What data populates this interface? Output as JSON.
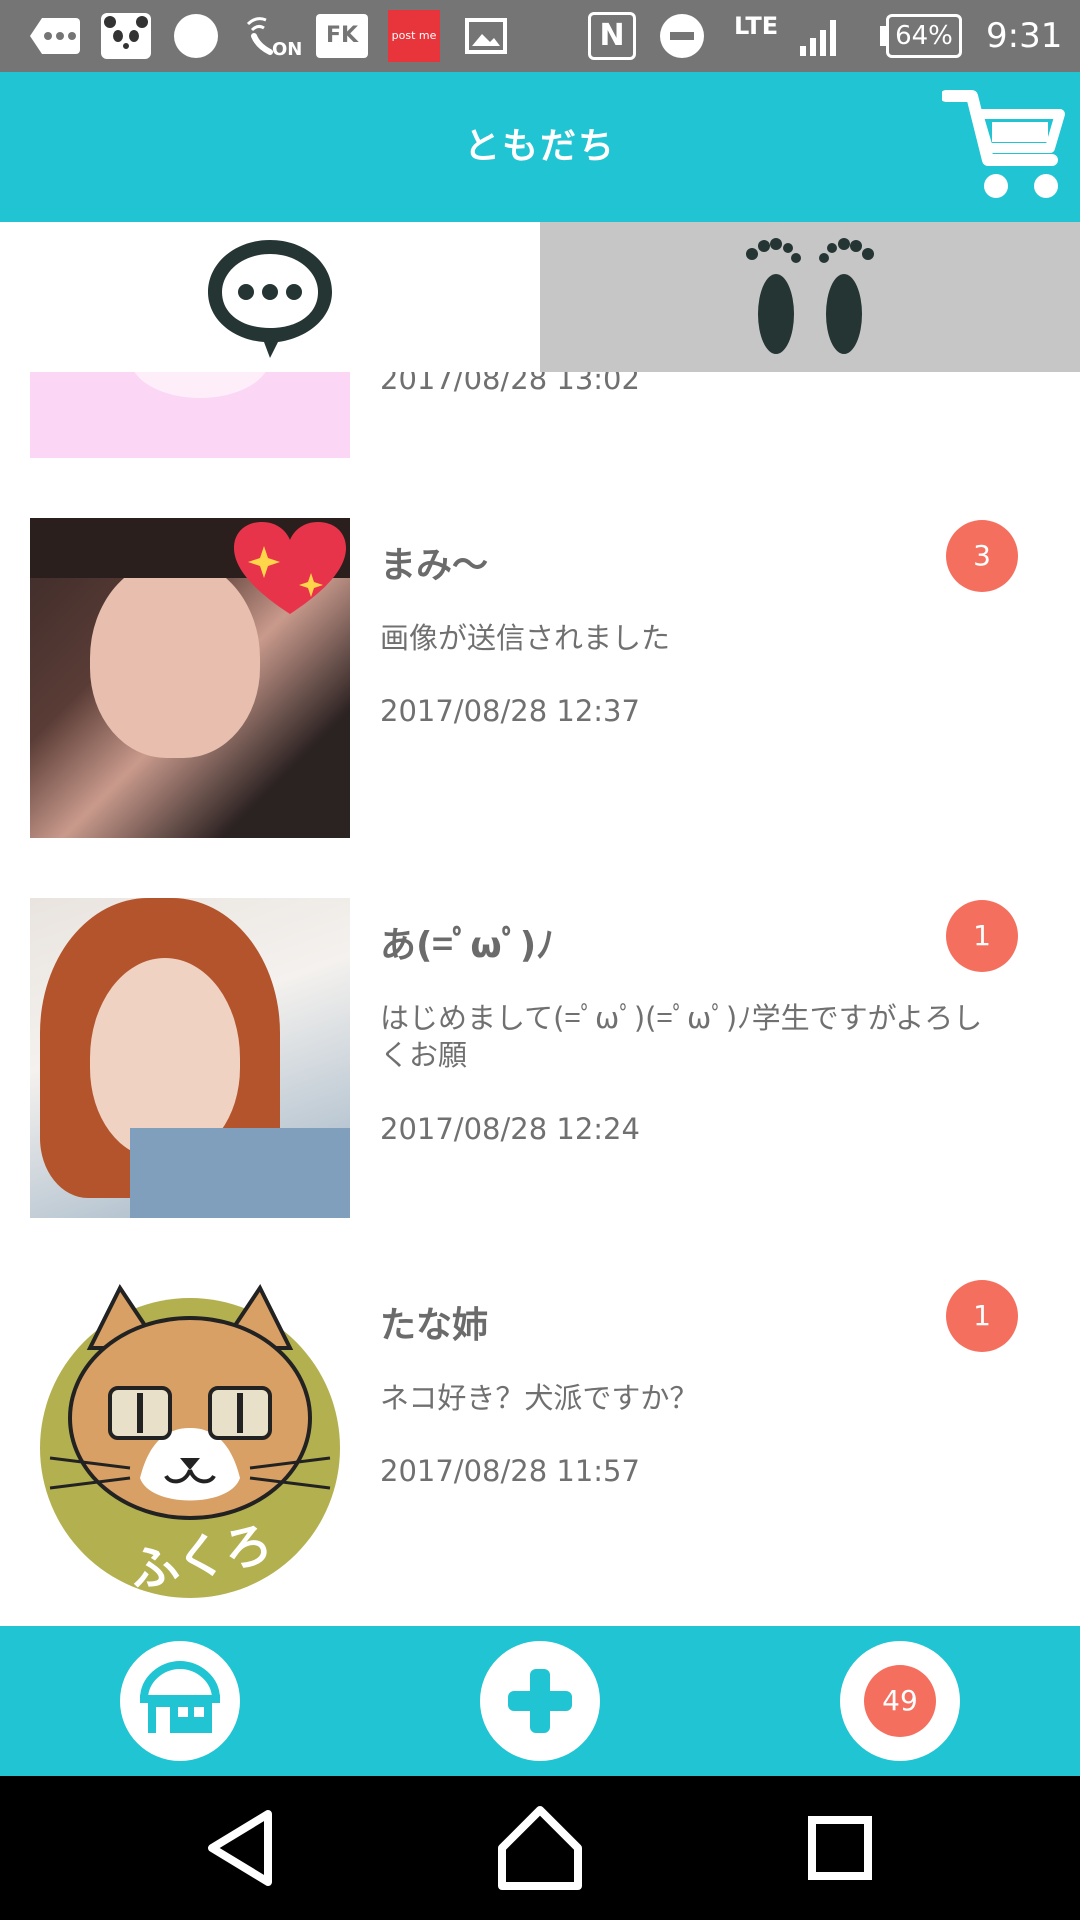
{
  "status_bar": {
    "network": "LTE",
    "battery": "64%",
    "time": "9:31",
    "nfc_label": "N",
    "fk_label": "FK",
    "postme_label": "post me",
    "on_label": "ON",
    "icons": [
      "chat-dots-icon",
      "panda-icon",
      "circle-icon",
      "wifi-calling-icon",
      "fk-app-icon",
      "postme-app-icon",
      "image-icon",
      "nfc-icon",
      "do-not-disturb-icon",
      "signal-icon",
      "battery-icon"
    ]
  },
  "header": {
    "title": "ともだち",
    "cart_icon": "cart-icon"
  },
  "tabs": [
    {
      "icon": "speech-bubble-icon",
      "selected": true
    },
    {
      "icon": "footprints-icon",
      "selected": false
    }
  ],
  "friends": [
    {
      "name": "",
      "message": "",
      "time": "2017/08/28 13:02",
      "avatar_color": "#fbd6f5"
    },
    {
      "name": "まみ〜",
      "message": "画像が送信されました",
      "time": "2017/08/28 12:37",
      "unread": "3"
    },
    {
      "name": "あ(=ﾟωﾟ)ﾉ",
      "message": "はじめまして(=ﾟωﾟ)(=ﾟωﾟ)ﾉ学生ですがよろしくお願",
      "time": "2017/08/28 12:24",
      "unread": "1"
    },
    {
      "name": "たな姉",
      "message": "ネコ好き？犬派ですか？",
      "time": "2017/08/28 11:57",
      "unread": "1",
      "avatar_text": "ふくろ"
    }
  ],
  "bottom_bar": {
    "home_icon": "home-icon",
    "add_icon": "plus-icon",
    "notification_count": "49"
  },
  "nav": [
    "back-icon",
    "home-nav-icon",
    "recents-icon"
  ],
  "colors": {
    "accent": "#20c4d2",
    "badge": "#f56f5f",
    "icon_dark": "#253534",
    "tab_inactive": "#c6c6c6"
  }
}
